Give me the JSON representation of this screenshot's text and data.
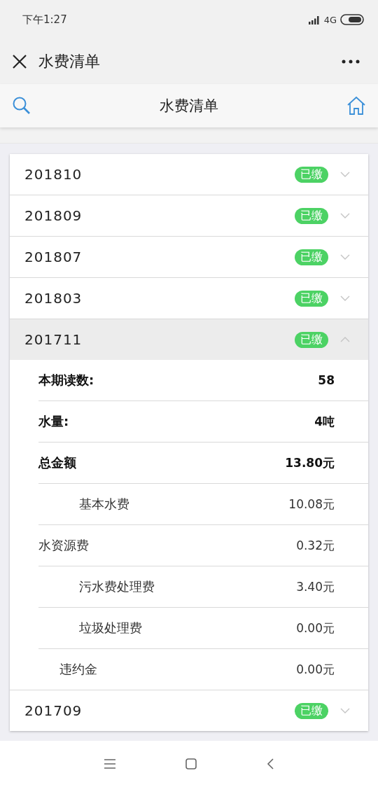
{
  "status_bar": {
    "time": "下午1:27",
    "network": "4G"
  },
  "nav_bar": {
    "title": "水费清单"
  },
  "header": {
    "title": "水费清单"
  },
  "bills": [
    {
      "period": "201810",
      "status": "已缴",
      "expanded": false
    },
    {
      "period": "201809",
      "status": "已缴",
      "expanded": false
    },
    {
      "period": "201807",
      "status": "已缴",
      "expanded": false
    },
    {
      "period": "201803",
      "status": "已缴",
      "expanded": false
    },
    {
      "period": "201711",
      "status": "已缴",
      "expanded": true,
      "details": [
        {
          "kind": "bold",
          "label": "本期读数:",
          "value": "58"
        },
        {
          "kind": "bold",
          "label": "水量:",
          "value": "4吨"
        },
        {
          "kind": "bold",
          "label": "总金额",
          "value": "13.80元"
        },
        {
          "kind": "sub",
          "label": "基本水费",
          "value": "10.08元"
        },
        {
          "kind": "plain",
          "label": "水资源费",
          "value": "0.32元"
        },
        {
          "kind": "sub",
          "label": "污水费处理费",
          "value": "3.40元"
        },
        {
          "kind": "sub",
          "label": "垃圾处理费",
          "value": "0.00元"
        },
        {
          "kind": "mid",
          "label": "违约金",
          "value": "0.00元"
        }
      ]
    },
    {
      "period": "201709",
      "status": "已缴",
      "expanded": false
    }
  ]
}
